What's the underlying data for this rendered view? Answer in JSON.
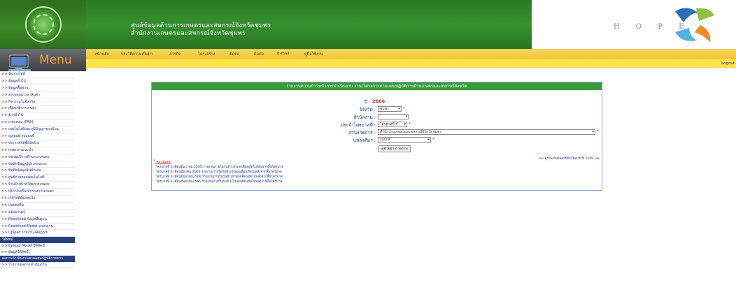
{
  "header": {
    "title_line1": "ศูนย์ข้อมูลด้านการเกษตรและสหกรณ์จังหวัดชุมพร",
    "title_line2": "สำนักงานเกษตรและสหกรณ์จังหวัดชุมพร",
    "hope_text": "H O P E"
  },
  "menu": {
    "label": "Menu"
  },
  "topnav": [
    "หน้าหลัก",
    "ประวัติความเป็นมา",
    "ภารกิจ",
    "โครงสร้าง",
    "ติดต่อ",
    "ติดต่อ",
    "E-mail",
    "คู่มือใช้งาน"
  ],
  "logout": "Logout",
  "sidebar": {
    "items": [
      ">> จัดการไฟล์",
      ">> ข้อมูลทั่วไป",
      ">> ข้อมูลพื้นฐาน",
      ">> ตรวจสอบราคาสินค้า",
      ">> กิจกรรมในจังหวัด",
      ">> เตือนภัยการเกษตร",
      ">> ข่าวทั่วไป",
      ">> ถาม-ตอบ (FAQ)",
      ">> เทคโนโลยีและภูมิปัญญาชาวบ้าน",
      ">> upload รูปแบบที่",
      ">> ประกาศจัดซื้อจัดจ้าง",
      ">> เกษตรกรแนะนำ",
      ">> หน่วยบริการด้านการเกษตร",
      ">> บันทึกข้อมูลผู้ประกอบการ",
      ">> บันทึกข้อมูลสินค้าเด่น",
      ">> ศูนย์ถ่ายทอดเทคโนโลยี",
      ">> ร้านจำหน่ายวัสดุการเกษตร",
      ">> บริการเครื่องจักรกลการเกษตร",
      ">> เว็บไซต์ที่น่าสนใจ",
      ">> แบบฟอร์ม",
      ">> คลังความรู้",
      ">> Download ข้อมูลพื้นฐาน",
      ">> Download Model มาตรฐาน",
      ">> Upload รายงาน iReport"
    ],
    "head1": "วีดีทัศน์",
    "sub1": [
      ">> Upload Model วีดีทัศน์",
      ">> ข้อมูลวีดีทัศน์"
    ],
    "head2": "ผลการดำเนินงานตามแผนปฏิบัติราชการ",
    "sub2": [
      ">> รายงานผลการดำเนินงาน"
    ]
  },
  "report": {
    "heading": "รายงานความก้าวหน้าการดำเนินงาน งาน/โครงการตามแผนปฏิบัติการด้านเกษตรและสหกรณ์จังหวัด",
    "year_label": "ปี :",
    "year_value": "2566",
    "province_label": "จังหวัด :",
    "province_value": "ชุมพร",
    "office_label": "สำนักงาน :",
    "office_value": "",
    "quarter_label": "ประจำไตรมาสที่ :",
    "quarter_value": "ไตรมาสที่ 4",
    "agency_label": "ส่วนราชการ :",
    "agency_value": "สำนักงานเกษตรและสหกรณ์จังหวัดชุมพร",
    "source_label": "แหล่งที่มา :",
    "source_value": "งบปกติ",
    "submit_label": "ดูตัวอย่างรายงาน",
    "prev_link": "<< ดูรายงานผลการดำเนินงาน ปี 2549 >>",
    "note_title": "หมายเหตุ",
    "notes": [
      "ไตรมาสที่ 1 เดือนธันวาคม 2565 รายงานภายในวันที่ 10 ของเดือนถัดไปหลังจากสิ้นไตรมาส",
      "ไตรมาสที่ 2 เดือนมีนาคม 2566 รายงานภายในวันที่ 10 ของเดือนถัดไปหลังจากสิ้นไตรมาส",
      "ไตรมาสที่ 3 เดือนมิถุนายน2566 รายงานภายในวันที่ 10 ของเดือนถัดไปหลังจากสิ้นไตรมาส",
      "ไตรมาสที่ 4 เดือนกันยายน2566 รายงานภายในวันที่ 10 ของเดือนถัดไปหลังจากสิ้นไตรมาส"
    ]
  },
  "colors": {
    "header_green": "#2c7a24",
    "nav_yellow": "#f1c631",
    "panel_green": "#3b9a3c",
    "required_red": "#d4282a"
  }
}
